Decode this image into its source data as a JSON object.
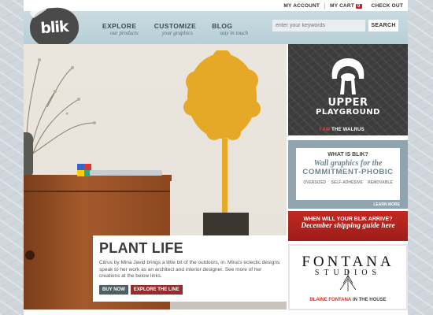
{
  "utility": {
    "account": "MY ACCOUNT",
    "cart": "MY CART",
    "cart_count": "0",
    "checkout": "CHECK OUT"
  },
  "logo": {
    "text": "blik"
  },
  "nav": [
    {
      "label": "EXPLORE",
      "sub": "our products"
    },
    {
      "label": "CUSTOMIZE",
      "sub": "your graphics"
    },
    {
      "label": "BLOG",
      "sub": "stay in touch"
    }
  ],
  "search": {
    "placeholder": "enter your keywords",
    "button": "SEARCH"
  },
  "hero": {
    "title": "PLANT LIFE",
    "description": "Citrus by Mina Javid brings a little bit of the outdoors, in. Mina's eclectic designs speak to her work as an architect and interior designer. See more of her creations at the below links.",
    "buy_label": "BUY NOW",
    "explore_label": "EXPLORE THE LINE"
  },
  "promo_upper": {
    "line1": "UPPER",
    "line2": "PLAYGROUND",
    "foot_prefix": "I AM",
    "foot_text": "THE WALRUS"
  },
  "promo_whatis": {
    "question": "WHAT IS BLIK?",
    "tagline1": "Wall graphics for the",
    "tagline2": "COMMITMENT-PHOBIC",
    "tags": [
      "OVERSIZED",
      "SELF-ADHESIVE",
      "REMOVABLE"
    ],
    "more": "LEARN MORE"
  },
  "promo_shipping": {
    "question": "WHEN WILL YOUR BLIK ARRIVE?",
    "link": "December shipping guide here"
  },
  "promo_fontana": {
    "line1": "FONTANA",
    "line2": "STUDIOS",
    "foot_prefix": "BLAINE FONTANA",
    "foot_text": "IN THE HOUSE"
  },
  "colors": {
    "header": "#c9dbe1",
    "accent_red": "#b8262b",
    "tree_orange": "#e5a927"
  }
}
